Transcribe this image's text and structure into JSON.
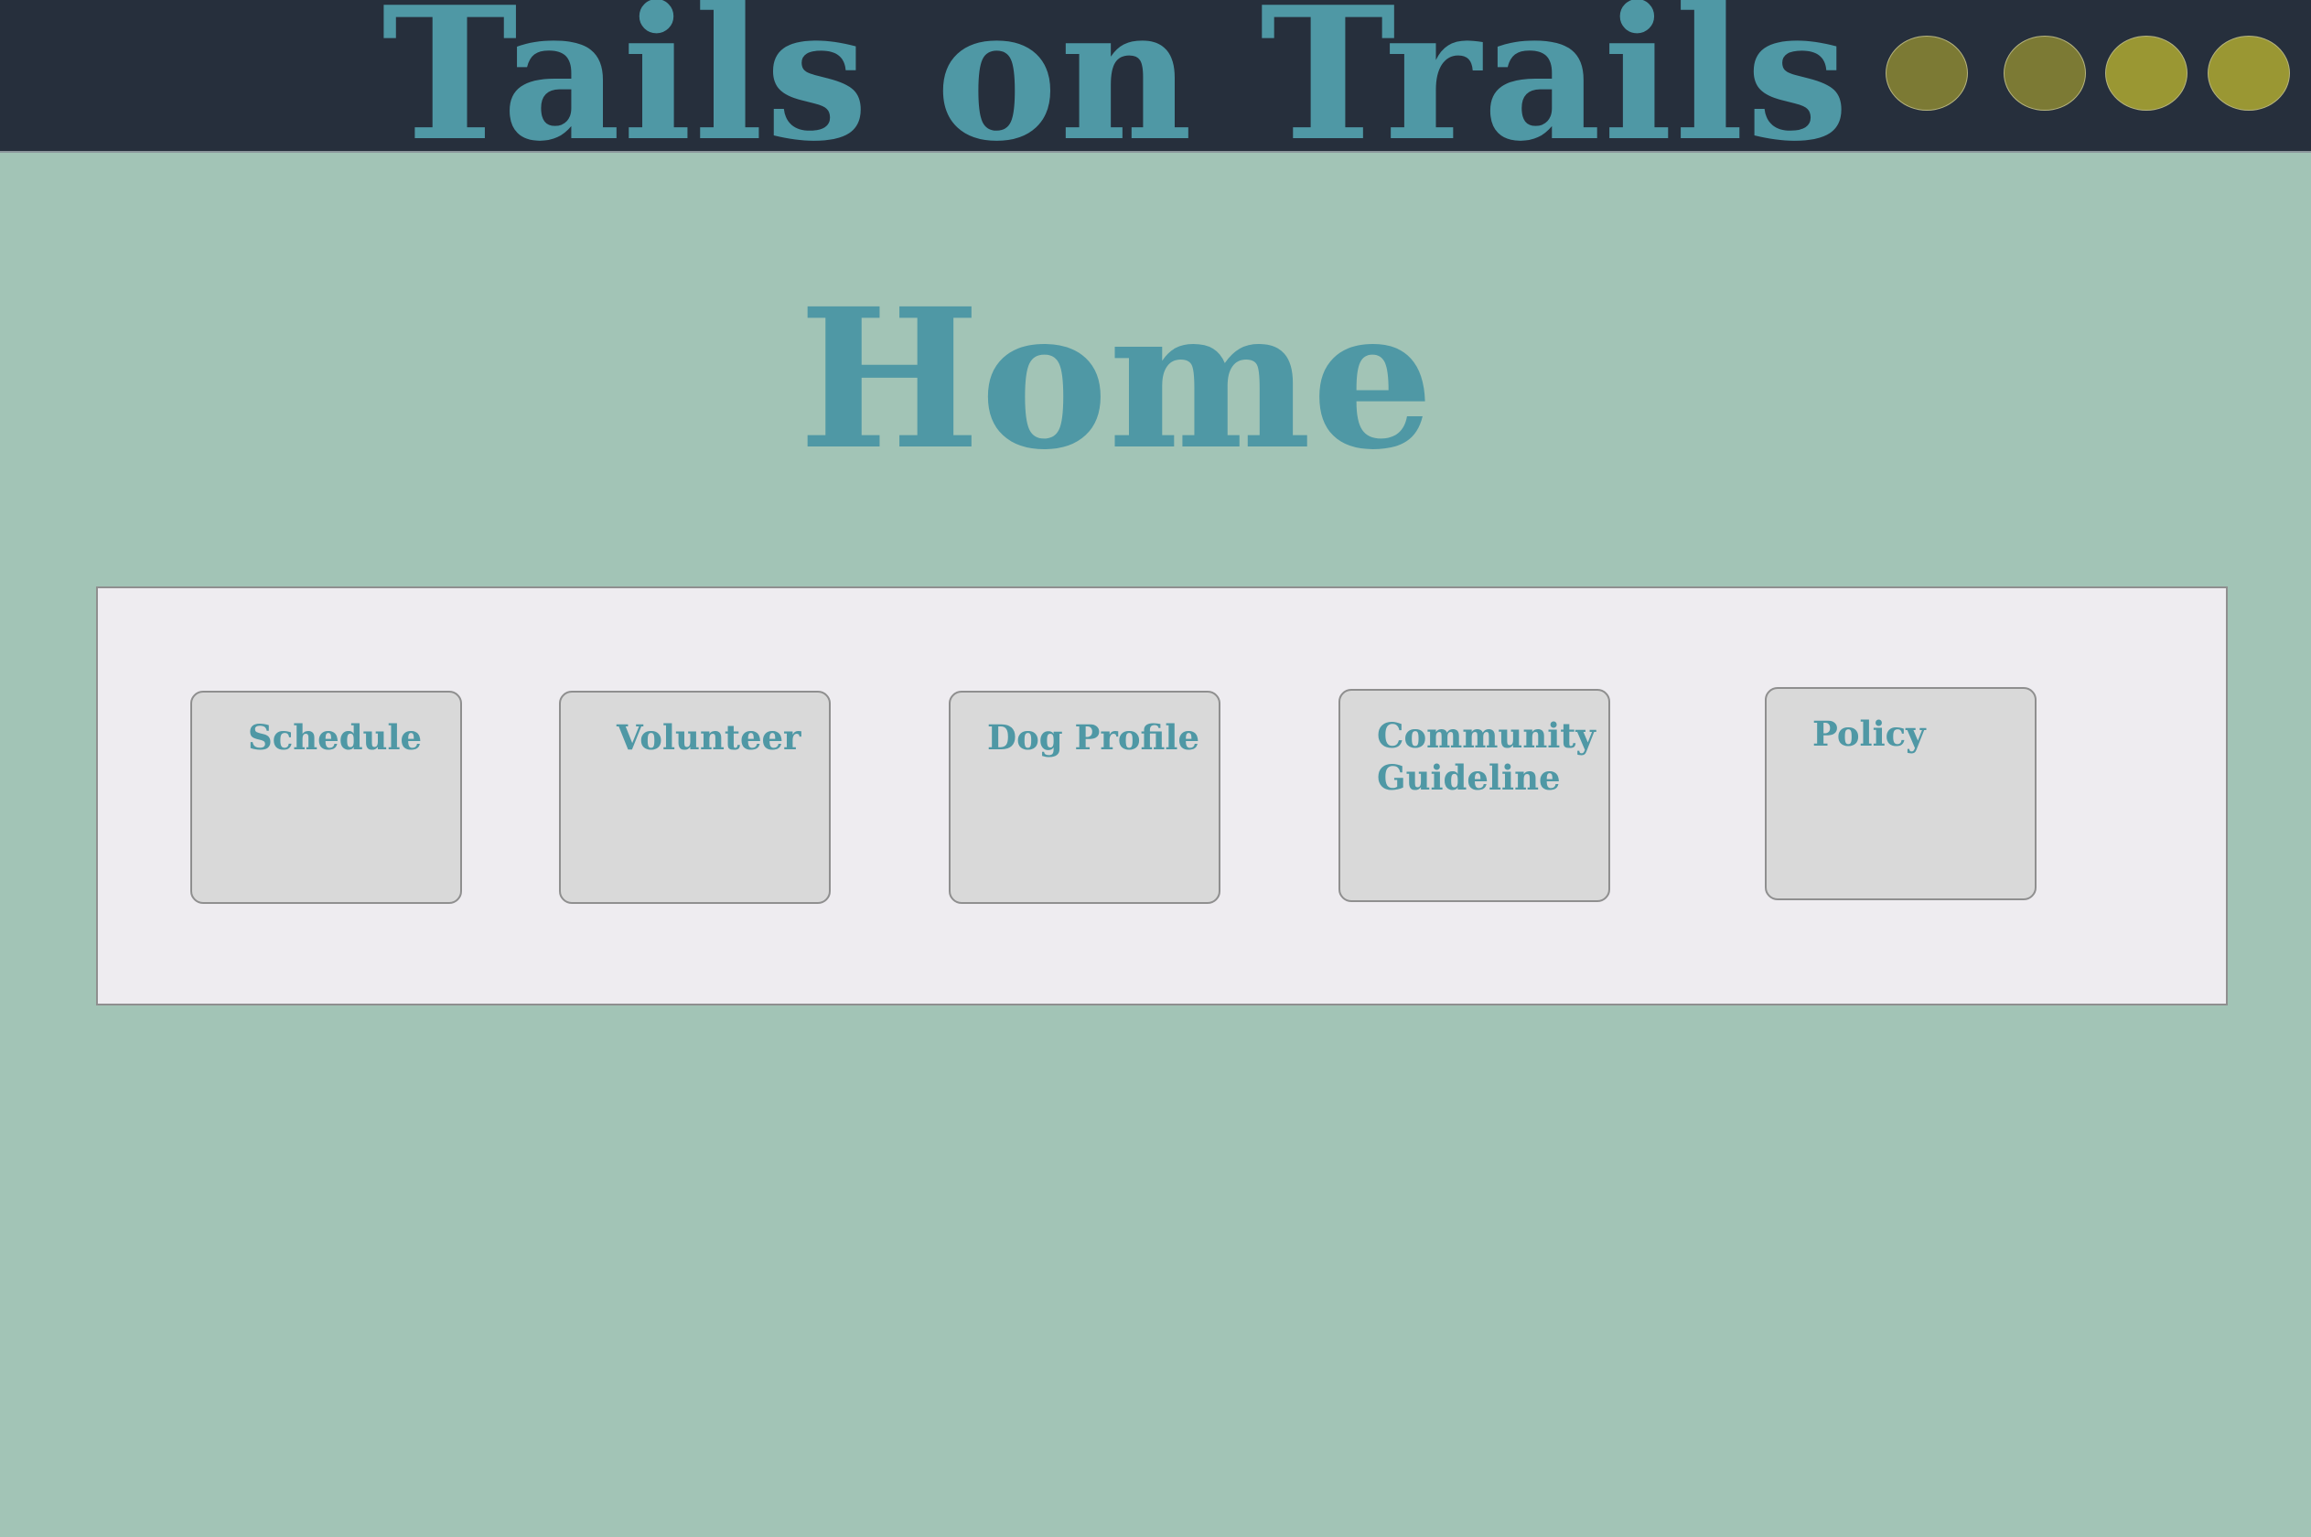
{
  "header": {
    "site_title": "Tails on Trails",
    "window_dots": [
      {
        "name": "dot-1",
        "color": "#7c7a34"
      },
      {
        "name": "dot-2",
        "color": "#7c7a34"
      },
      {
        "name": "dot-3",
        "color": "#9a9733"
      },
      {
        "name": "dot-4",
        "color": "#9a9733"
      }
    ]
  },
  "main": {
    "page_title": "Home",
    "nav_cards": [
      {
        "label": "Schedule"
      },
      {
        "label": "Volunteer"
      },
      {
        "label": "Dog Profile"
      },
      {
        "label": "Community Guideline"
      },
      {
        "label": "Policy"
      }
    ]
  },
  "colors": {
    "background": "#a2c4b6",
    "header_background": "#262f3c",
    "accent_text": "#4f98a5",
    "panel_background": "#eeecf0",
    "card_background": "#d9d9d9"
  }
}
